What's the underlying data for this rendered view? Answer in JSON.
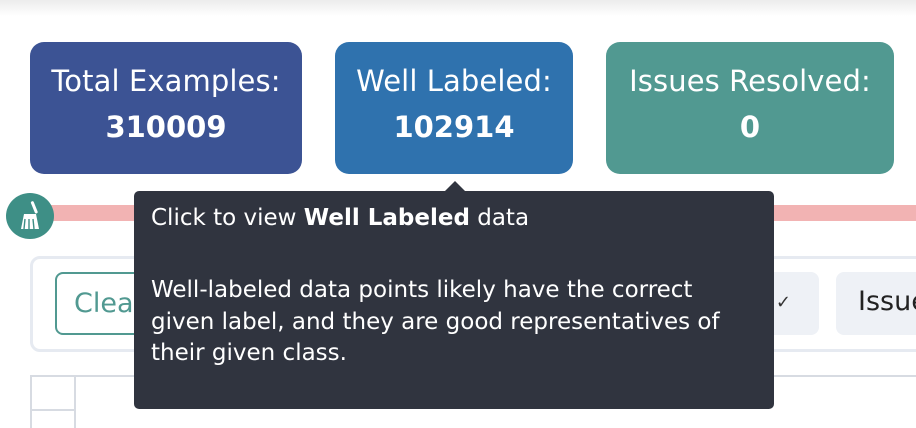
{
  "cards": {
    "total": {
      "label": "Total Examples:",
      "value": "310009",
      "color": "#3c5394"
    },
    "well": {
      "label": "Well Labeled:",
      "value": "102914",
      "color": "#2f72ae"
    },
    "issues": {
      "label": "Issues Resolved:",
      "value": "0",
      "color": "#519991"
    }
  },
  "toolbar": {
    "broom_icon": "broom-icon",
    "clear_label": "Clear",
    "issues_label": "Issues"
  },
  "tooltip": {
    "prefix": "Click to view ",
    "emphasis": "Well Labeled",
    "suffix": " data",
    "body": "Well-labeled data points likely have the correct given label, and they are good representatives of their given class."
  },
  "colors": {
    "progress_track": "#f2b3b3",
    "tooltip_bg": "#30343f",
    "accent_teal": "#519991"
  }
}
